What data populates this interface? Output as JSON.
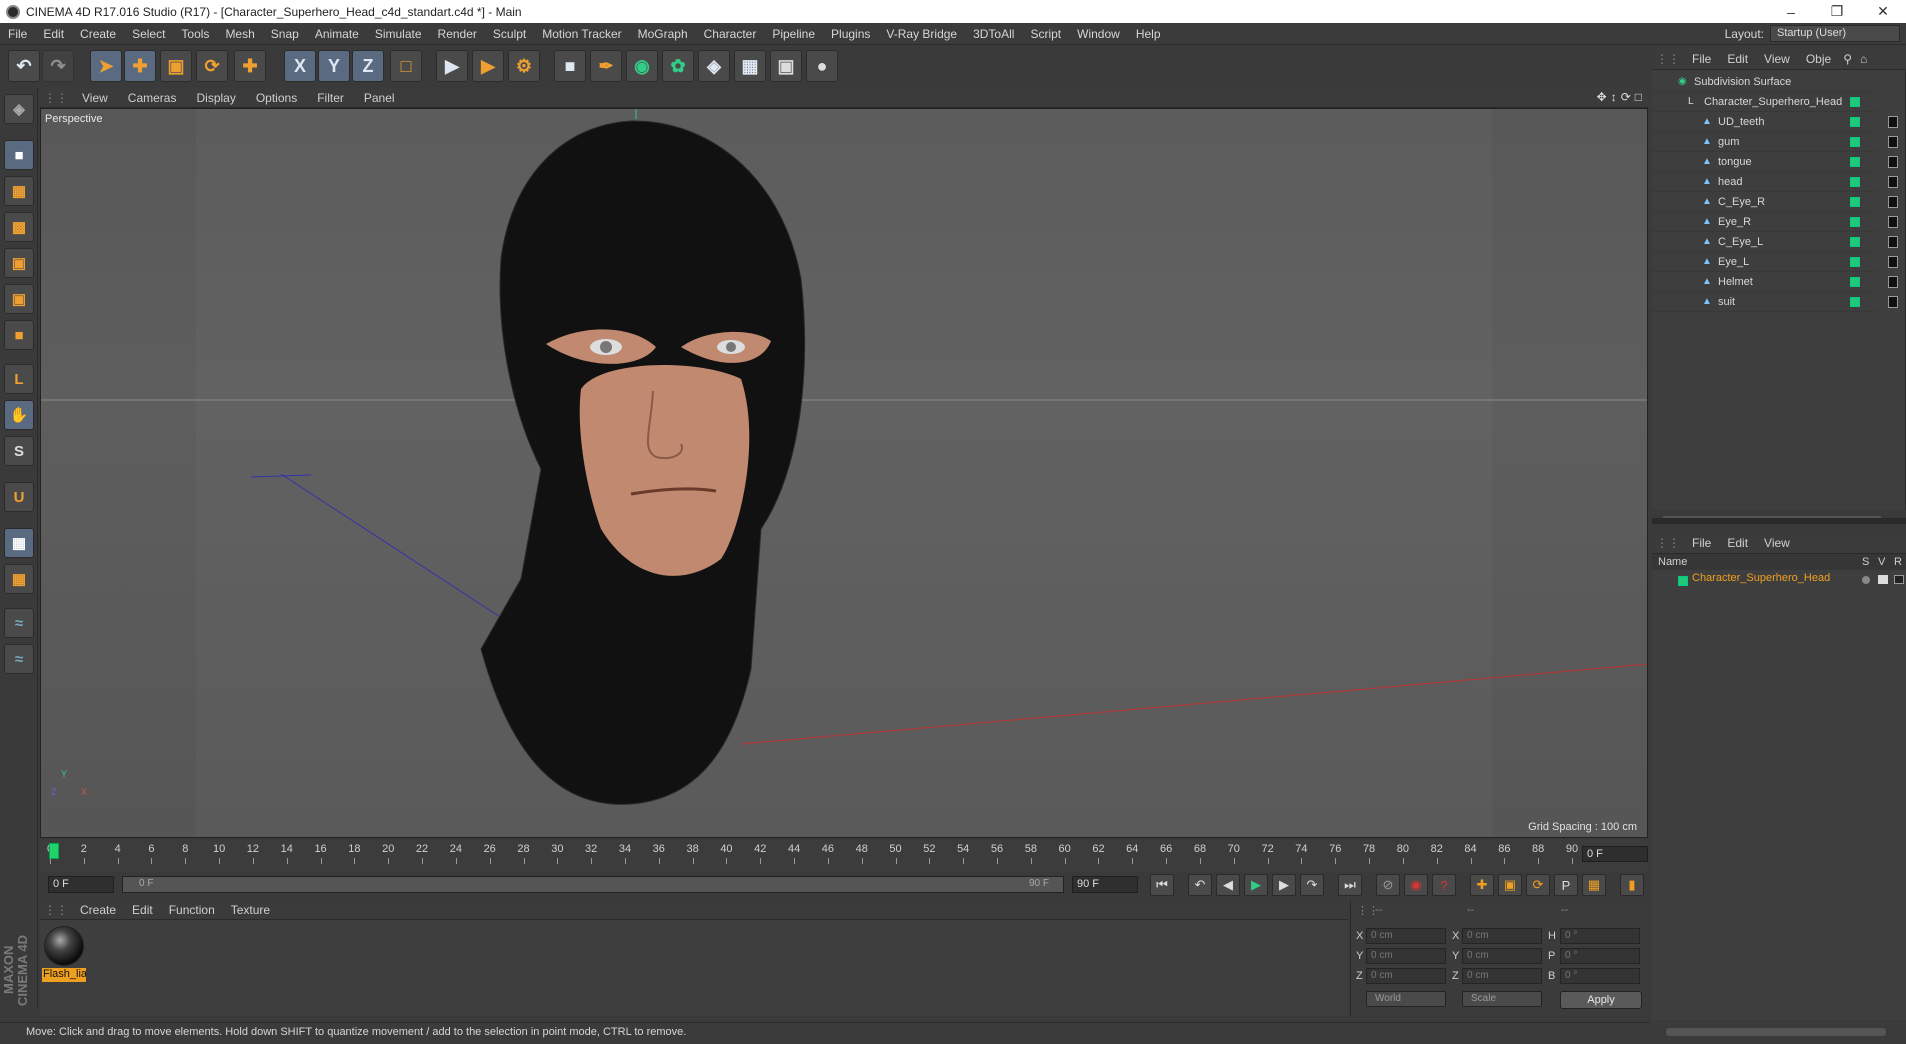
{
  "window": {
    "title": "CINEMA 4D R17.016 Studio (R17) - [Character_Superhero_Head_c4d_standart.c4d *] - Main"
  },
  "menubar": {
    "items": [
      "File",
      "Edit",
      "Create",
      "Select",
      "Tools",
      "Mesh",
      "Snap",
      "Animate",
      "Simulate",
      "Render",
      "Sculpt",
      "Motion Tracker",
      "MoGraph",
      "Character",
      "Pipeline",
      "Plugins",
      "V-Ray Bridge",
      "3DToAll",
      "Script",
      "Window",
      "Help"
    ],
    "layout_label": "Layout:",
    "layout_value": "Startup (User)"
  },
  "toolbar": {
    "axis_x": "X",
    "axis_y": "Y",
    "axis_z": "Z"
  },
  "viewport": {
    "menu": [
      "View",
      "Cameras",
      "Display",
      "Options",
      "Filter",
      "Panel"
    ],
    "label": "Perspective",
    "grid_spacing": "Grid Spacing : 100 cm",
    "axis_y": "Y",
    "axis_z": "Z",
    "axis_x": "X"
  },
  "timeline": {
    "ticks": [
      "0",
      "2",
      "4",
      "6",
      "8",
      "10",
      "12",
      "14",
      "16",
      "18",
      "20",
      "22",
      "24",
      "26",
      "28",
      "30",
      "32",
      "34",
      "36",
      "38",
      "40",
      "42",
      "44",
      "46",
      "48",
      "50",
      "52",
      "54",
      "56",
      "58",
      "60",
      "62",
      "64",
      "66",
      "68",
      "70",
      "72",
      "74",
      "76",
      "78",
      "80",
      "82",
      "84",
      "86",
      "88",
      "90"
    ],
    "frame_end": "0 F",
    "start_field": "0 F",
    "slider_start": "0 F",
    "slider_end": "90 F",
    "end_field": "90 F"
  },
  "material_manager": {
    "menu": [
      "Create",
      "Edit",
      "Function",
      "Texture"
    ],
    "material_name": "Flash_lia"
  },
  "coordinates": {
    "header_dashes": [
      "--",
      "--",
      "--"
    ],
    "rows": [
      {
        "a": "X",
        "av": "0 cm",
        "b": "X",
        "bv": "0 cm",
        "c": "H",
        "cv": "0 °"
      },
      {
        "a": "Y",
        "av": "0 cm",
        "b": "Y",
        "bv": "0 cm",
        "c": "P",
        "cv": "0 °"
      },
      {
        "a": "Z",
        "av": "0 cm",
        "b": "Z",
        "bv": "0 cm",
        "c": "B",
        "cv": "0 °"
      }
    ],
    "world": "World",
    "scale": "Scale",
    "apply": "Apply"
  },
  "status": {
    "text": "Move: Click and drag to move elements. Hold down SHIFT to quantize movement / add to the selection in point mode, CTRL to remove."
  },
  "object_manager": {
    "menu": [
      "File",
      "Edit",
      "View",
      "Obje"
    ],
    "objects": [
      "Subdivision Surface",
      "Character_Superhero_Head",
      "UD_teeth",
      "gum",
      "tongue",
      "head",
      "C_Eye_R",
      "Eye_R",
      "C_Eye_L",
      "Eye_L",
      "Helmet",
      "suit"
    ]
  },
  "layer_manager": {
    "menu": [
      "File",
      "Edit",
      "View"
    ],
    "columns": [
      "Name",
      "S",
      "V",
      "R"
    ],
    "layer": "Character_Superhero_Head"
  },
  "maxon": "MAXON CINEMA 4D",
  "colors": {
    "accent": "#f0a020",
    "check": "#20c878",
    "bg": "#3a3a3a"
  }
}
